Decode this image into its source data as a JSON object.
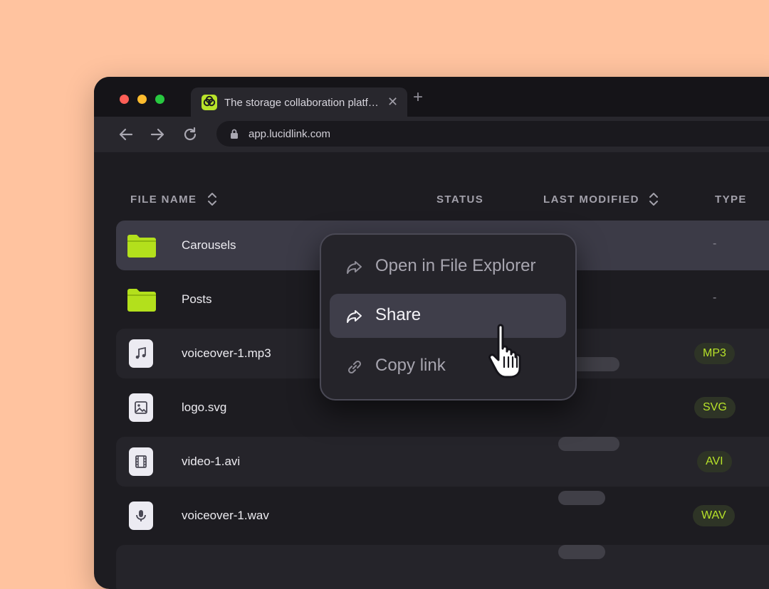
{
  "browser": {
    "tab_title": "The storage collaboration platf…",
    "tab_close": "✕",
    "new_tab": "+",
    "url": "app.lucidlink.com"
  },
  "table": {
    "columns": {
      "file_name": "FILE NAME",
      "status": "STATUS",
      "last_modified": "LAST MODIFIED",
      "type": "TYPE"
    },
    "rows": [
      {
        "name": "Carousels",
        "kind": "folder",
        "type": "-",
        "icon": "folder-icon"
      },
      {
        "name": "Posts",
        "kind": "folder",
        "type": "-",
        "icon": "folder-icon"
      },
      {
        "name": "voiceover-1.mp3",
        "kind": "file",
        "type": "MP3",
        "icon": "music-note-icon"
      },
      {
        "name": "logo.svg",
        "kind": "file",
        "type": "SVG",
        "icon": "image-icon"
      },
      {
        "name": "video-1.avi",
        "kind": "file",
        "type": "AVI",
        "icon": "film-icon"
      },
      {
        "name": "voiceover-1.wav",
        "kind": "file",
        "type": "WAV",
        "icon": "microphone-icon"
      }
    ]
  },
  "context_menu": {
    "items": [
      {
        "label": "Open in File Explorer",
        "icon": "share-arrow-icon"
      },
      {
        "label": "Share",
        "icon": "share-arrow-icon"
      },
      {
        "label": "Copy link",
        "icon": "link-icon"
      }
    ]
  },
  "colors": {
    "background": "#FFC39F",
    "window": "#1D1C21",
    "accent": "#B8E32A",
    "selected_row": "#3C3B47"
  }
}
